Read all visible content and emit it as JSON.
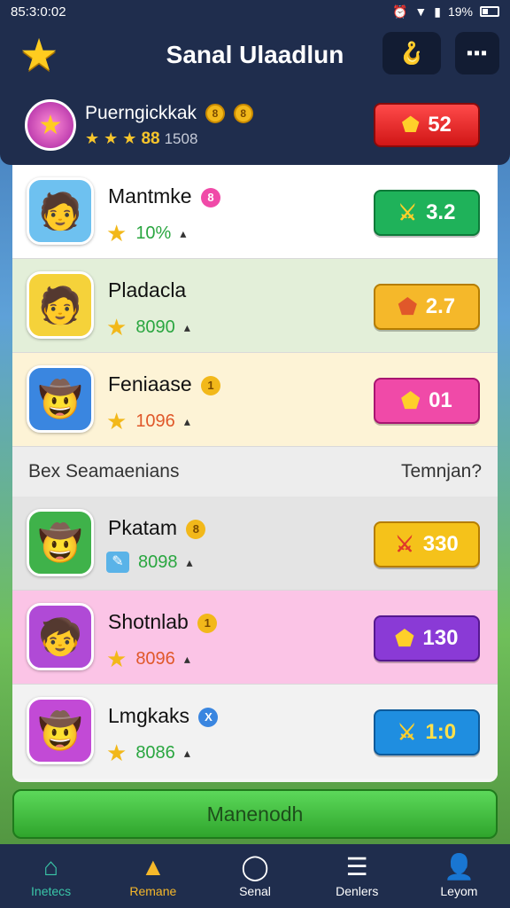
{
  "status": {
    "time": "85:3:0:02",
    "battery": "19%"
  },
  "header": {
    "title": "Sanal Ulaadlun",
    "logo_icon": "star-icon",
    "hook_icon": "hook-icon",
    "menu_icon": "menu-icon"
  },
  "player": {
    "name": "Puerngickkak",
    "coin_a": "8",
    "coin_b": "8",
    "score": "88",
    "total": "1508",
    "badge_value": "52"
  },
  "rows_top": [
    {
      "name": "Mantmke",
      "tag": "8",
      "stat": "10%",
      "button": "3.2",
      "color": "#1fb25a"
    },
    {
      "name": "Pladacla",
      "tag": "",
      "stat": "8090",
      "button": "2.7",
      "color": "#f5b82a"
    },
    {
      "name": "Feniaase",
      "tag": "1",
      "stat": "1096",
      "button": "01",
      "color": "#f04aa8"
    }
  ],
  "section": {
    "left": "Bex Seamaenians",
    "right": "Temnjan?"
  },
  "rows_bottom": [
    {
      "name": "Pkatam",
      "tag": "8",
      "stat": "8098",
      "button": "330",
      "color": "#f5c21a"
    },
    {
      "name": "Shotnlab",
      "tag": "1",
      "stat": "8096",
      "button": "130",
      "color": "#8a3ad6"
    },
    {
      "name": "Lmgkaks",
      "tag": "X",
      "stat": "8086",
      "button": "1:0",
      "color": "#1f8ee0"
    }
  ],
  "main_button": "Manenodh",
  "nav": [
    {
      "label": "Inetecs",
      "icon": "home-icon",
      "active": true
    },
    {
      "label": "Remane",
      "icon": "tent-icon",
      "active": false
    },
    {
      "label": "Senal",
      "icon": "circle-icon",
      "active": false
    },
    {
      "label": "Denlers",
      "icon": "list-icon",
      "active": false
    },
    {
      "label": "Leyom",
      "icon": "user-icon",
      "active": false
    }
  ]
}
